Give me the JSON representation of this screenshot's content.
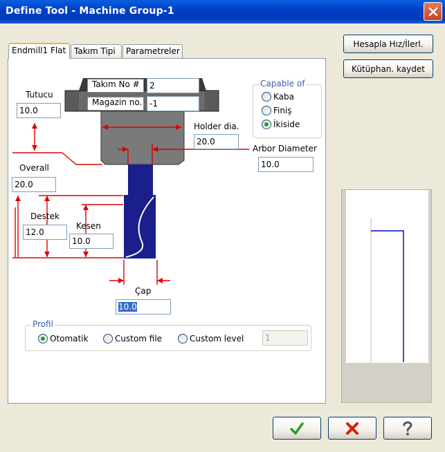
{
  "window": {
    "title": "Define Tool - Machine Group-1"
  },
  "tabs": [
    {
      "label": "Endmill1 Flat"
    },
    {
      "label": "Takım Tipi"
    },
    {
      "label": "Parametreler"
    }
  ],
  "tool_header": {
    "tool_no_label": "Takım No #",
    "tool_no_value": "2",
    "magazine_label": "Magazin no.",
    "magazine_value": "-1"
  },
  "capable_of": {
    "title": "Capable of",
    "options": [
      "Kaba",
      "Finiş",
      "İkiside"
    ],
    "selected": "İkiside"
  },
  "dimensions": {
    "tutucu_label": "Tutucu",
    "tutucu_value": "10.0",
    "holder_dia_label": "Holder dia.",
    "holder_dia_value": "20.0",
    "arbor_label": "Arbor Diameter",
    "arbor_value": "10.0",
    "overall_label": "Overall",
    "overall_value": "20.0",
    "destek_label": "Destek",
    "destek_value": "12.0",
    "kesen_label": "Kesen",
    "kesen_value": "10.0",
    "cap_label": "Çap",
    "cap_value": "10.0"
  },
  "profil": {
    "title": "Profil",
    "options": [
      "Otomatik",
      "Custom file",
      "Custom level"
    ],
    "selected": "Otomatik",
    "level_value": "1"
  },
  "side_buttons": {
    "calc_label": "Hesapla Hız/İlerl.",
    "save_library_label": "Kütüphan. kaydet"
  },
  "colors": {
    "titlebar": "#0041c8",
    "tool_body": "#1a1f8c",
    "dimension_lines": "#e00000",
    "ok_check": "#2a9a2a",
    "cancel_x": "#d81e05",
    "preview_outline": "#0000c0"
  },
  "icons": {
    "close": "close-icon",
    "ok": "checkmark-icon",
    "cancel": "x-icon",
    "help": "question-icon"
  }
}
